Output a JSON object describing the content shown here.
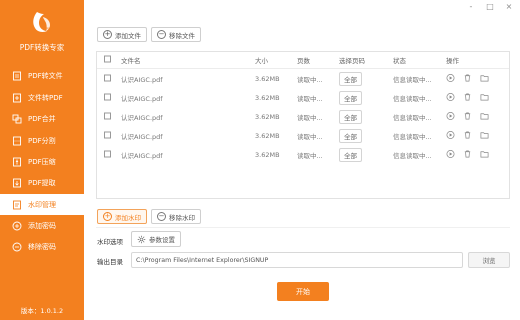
{
  "app": {
    "title": "PDF转换专家",
    "version": "版本：1.0.1.2",
    "logo_text": "PDF",
    "accent": "#f3801f"
  },
  "sidebar": {
    "items": [
      {
        "label": "PDF转文件",
        "icon": "file-convert-icon",
        "active": false
      },
      {
        "label": "文件转PDF",
        "icon": "to-pdf-icon",
        "active": false
      },
      {
        "label": "PDF合并",
        "icon": "merge-icon",
        "active": false
      },
      {
        "label": "PDF分割",
        "icon": "split-icon",
        "active": false
      },
      {
        "label": "PDF压缩",
        "icon": "compress-icon",
        "active": false
      },
      {
        "label": "PDF提取",
        "icon": "extract-icon",
        "active": false
      },
      {
        "label": "水印管理",
        "icon": "watermark-icon",
        "active": true
      },
      {
        "label": "添加密码",
        "icon": "add-password-icon",
        "active": false
      },
      {
        "label": "移除密码",
        "icon": "remove-password-icon",
        "active": false
      }
    ]
  },
  "window": {
    "controls": [
      "-",
      "□",
      "×"
    ]
  },
  "toolbar": {
    "add_file": "添加文件",
    "remove_file": "移除文件"
  },
  "table": {
    "headers": {
      "name": "文件名",
      "size": "大小",
      "pages": "页数",
      "select_pages": "选择页码",
      "status": "状态",
      "actions": "操作"
    },
    "rows": [
      {
        "name": "认识AIGC.pdf",
        "size": "3.62MB",
        "pages": "读取中...",
        "select": "全部",
        "status": "信息读取中..."
      },
      {
        "name": "认识AIGC.pdf",
        "size": "3.62MB",
        "pages": "读取中...",
        "select": "全部",
        "status": "信息读取中..."
      },
      {
        "name": "认识AIGC.pdf",
        "size": "3.62MB",
        "pages": "读取中...",
        "select": "全部",
        "status": "信息读取中..."
      },
      {
        "name": "认识AIGC.pdf",
        "size": "3.62MB",
        "pages": "读取中...",
        "select": "全部",
        "status": "信息读取中..."
      },
      {
        "name": "认识AIGC.pdf",
        "size": "3.62MB",
        "pages": "读取中...",
        "select": "全部",
        "status": "信息读取中..."
      }
    ]
  },
  "watermark": {
    "add": "添加水印",
    "remove": "移除水印",
    "options_label": "水印选项",
    "settings_button": "参数设置"
  },
  "output": {
    "label": "输出目录",
    "path": "C:\\Program Files\\Internet Explorer\\SIGNUP",
    "browse": "浏览"
  },
  "start_button": "开始"
}
